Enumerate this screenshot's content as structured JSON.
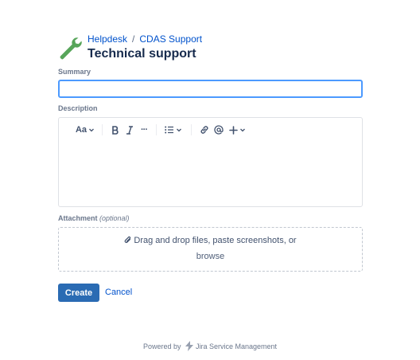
{
  "header": {
    "breadcrumb": [
      "Helpdesk",
      "CDAS Support"
    ],
    "breadcrumb_separator": "/",
    "title": "Technical support",
    "icon": "wrench-icon",
    "icon_color": "#57a55a"
  },
  "form": {
    "summary": {
      "label": "Summary",
      "value": "",
      "focus_color": "#4c9aff"
    },
    "description": {
      "label": "Description",
      "toolbar": {
        "text_style_label": "Aa",
        "items": [
          "text-style",
          "bold",
          "italic",
          "more-formatting",
          "bullet-list",
          "link",
          "mention",
          "insert"
        ],
        "more_label": "···"
      }
    },
    "attachment": {
      "label": "Attachment",
      "label_hint": "(optional)",
      "drop_text": "Drag and drop files, paste screenshots, or",
      "browse_label": "browse"
    }
  },
  "actions": {
    "create_label": "Create",
    "cancel_label": "Cancel",
    "primary_color": "#2a6bb3"
  },
  "footer": {
    "prefix": "Powered by",
    "product": "Jira Service Management"
  }
}
